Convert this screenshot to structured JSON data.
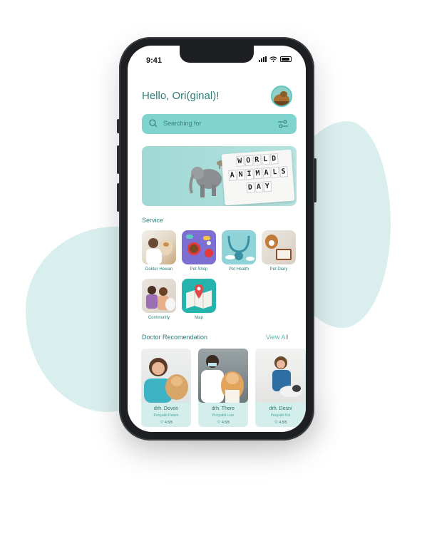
{
  "status_bar": {
    "time": "9:41"
  },
  "header": {
    "greeting": "Hello, Ori(ginal)!"
  },
  "search": {
    "placeholder": "Searching for"
  },
  "banner": {
    "row1": [
      "W",
      "O",
      "R",
      "L",
      "D"
    ],
    "row2": [
      "A",
      "N",
      "I",
      "M",
      "A",
      "L",
      "S"
    ],
    "row3": [
      "D",
      "A",
      "Y"
    ]
  },
  "services": {
    "title": "Service",
    "items": [
      {
        "label": "Dokter Hewan"
      },
      {
        "label": "Pet Shop"
      },
      {
        "label": "Pet Health"
      },
      {
        "label": "Pet Diary"
      },
      {
        "label": "Community"
      },
      {
        "label": "Map"
      }
    ]
  },
  "doctors": {
    "title": "Doctor Recomendation",
    "view_all": "View All",
    "items": [
      {
        "name": "drh. Devon",
        "specialty": "Penyakit Dalam",
        "rating": "4.5/5"
      },
      {
        "name": "drh. There",
        "specialty": "Penyakit Luar",
        "rating": "4.5/5"
      },
      {
        "name": "drh. Desni",
        "specialty": "Penyakit Kiri",
        "rating": "4.5/5"
      }
    ]
  },
  "colors": {
    "accent": "#7fd4cf",
    "text": "#2e7c77",
    "card": "#d3eeeb"
  }
}
